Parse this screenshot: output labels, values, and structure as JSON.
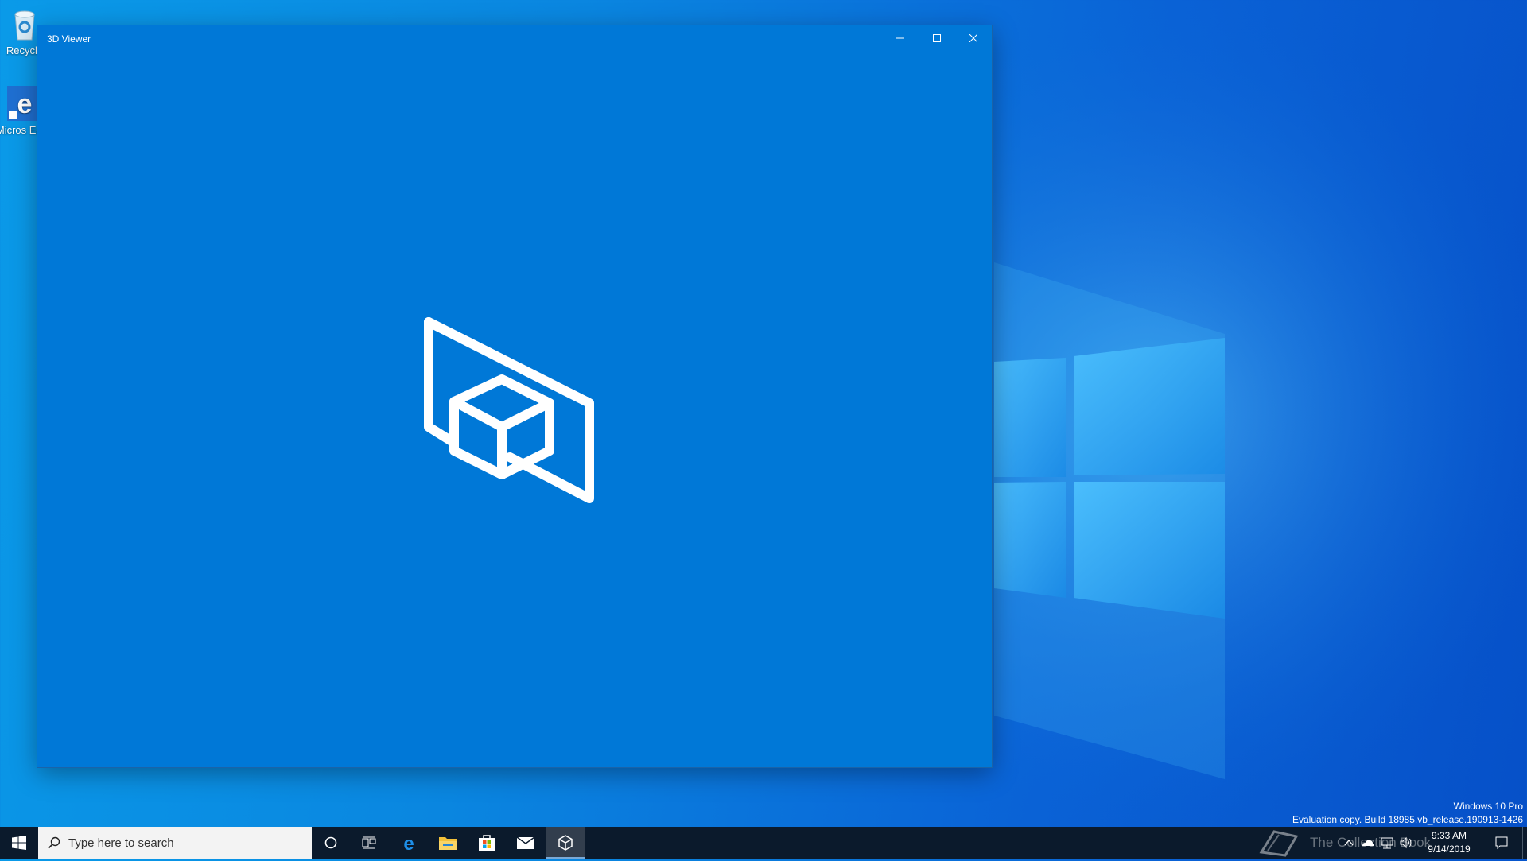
{
  "desktop": {
    "icons": [
      {
        "label": "Recycle",
        "icon": "recycle-bin-icon"
      },
      {
        "label": "Micros Edge",
        "icon": "edge-icon"
      }
    ]
  },
  "window": {
    "title": "3D Viewer",
    "controls": {
      "minimize": "minimize-icon",
      "maximize": "maximize-icon",
      "close": "close-icon"
    },
    "background": "#0078d7",
    "splash_icon": "3d-viewer-logo-icon"
  },
  "watermark": {
    "line1": "Windows 10 Pro",
    "line2": "Evaluation copy. Build 18985.vb_release.190913-1426"
  },
  "taskbar": {
    "search_placeholder": "Type here to search",
    "pinned": [
      "cortana-icon",
      "task-view-icon",
      "edge-icon",
      "file-explorer-icon",
      "store-icon",
      "mail-icon",
      "3d-viewer-icon"
    ],
    "active": "3d-viewer-icon",
    "tray_overlay_text": "The Collection Book",
    "clock": {
      "time": "9:33 AM",
      "date": "9/14/2019"
    }
  }
}
